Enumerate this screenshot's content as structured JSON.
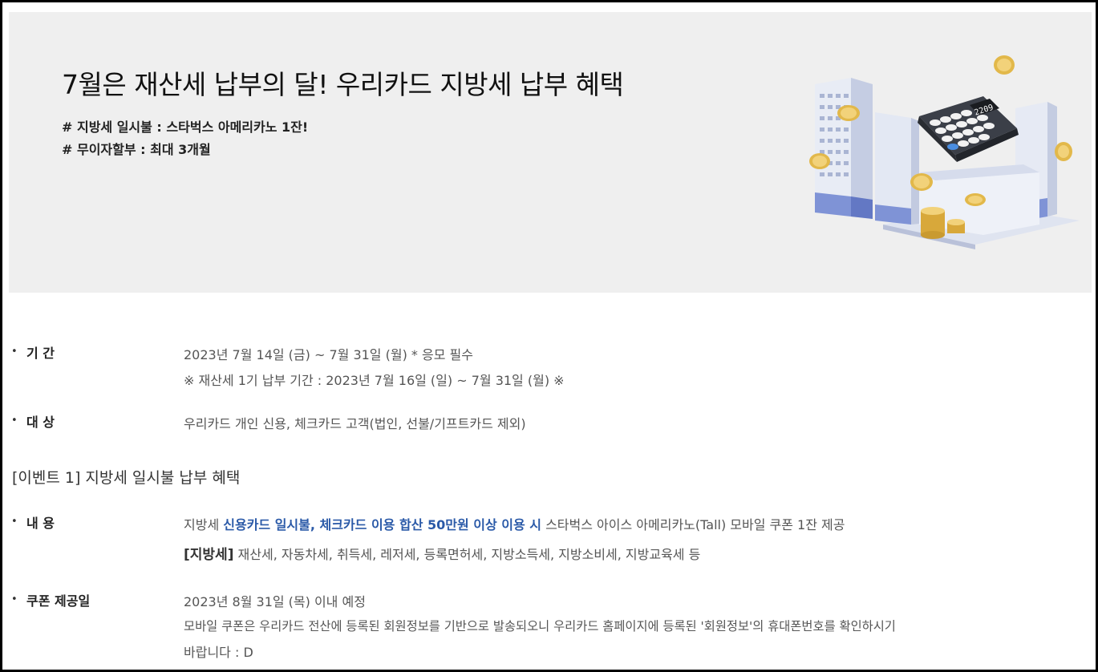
{
  "banner": {
    "title": "7월은 재산세 납부의 달! 우리카드 지방세 납부 혜택",
    "tag1": "# 지방세 일시불 : 스타벅스 아메리카노 1잔!",
    "tag2": "# 무이자할부 : 최대 3개월",
    "calculator_display": "2209"
  },
  "period": {
    "label": "기 간",
    "line1": "2023년 7월 14일 (금) ~ 7월 31일 (월) * 응모 필수",
    "line2": "※ 재산세 1기 납부 기간 : 2023년 7월 16일 (일) ~ 7월 31일 (월) ※"
  },
  "target": {
    "label": "대 상",
    "line1": "우리카드 개인 신용, 체크카드 고객(법인, 선불/기프트카드 제외)"
  },
  "event1": {
    "title": "[이벤트 1] 지방세 일시불 납부 혜택"
  },
  "content": {
    "label": "내 용",
    "line1_pre": "지방세 ",
    "line1_highlight": "신용카드 일시불, 체크카드 이용 합산 50만원 이상 이용 시",
    "line1_post": " 스타벅스 아이스 아메리카노(Tall) 모바일 쿠폰 1잔 제공",
    "line2_bracket": "[지방세]",
    "line2_rest": " 재산세, 자동차세, 취득세, 레저세, 등록면허세, 지방소득세, 지방소비세, 지방교육세 등"
  },
  "coupon": {
    "label": "쿠폰 제공일",
    "line1": "2023년 8월 31일 (목) 이내 예정",
    "line2": "모바일 쿠폰은 우리카드 전산에 등록된 회원정보를 기반으로 발송되오니 우리카드 홈페이지에 등록된 '회원정보'의 휴대폰번호를 확인하시기",
    "line3": "바랍니다 : D"
  }
}
